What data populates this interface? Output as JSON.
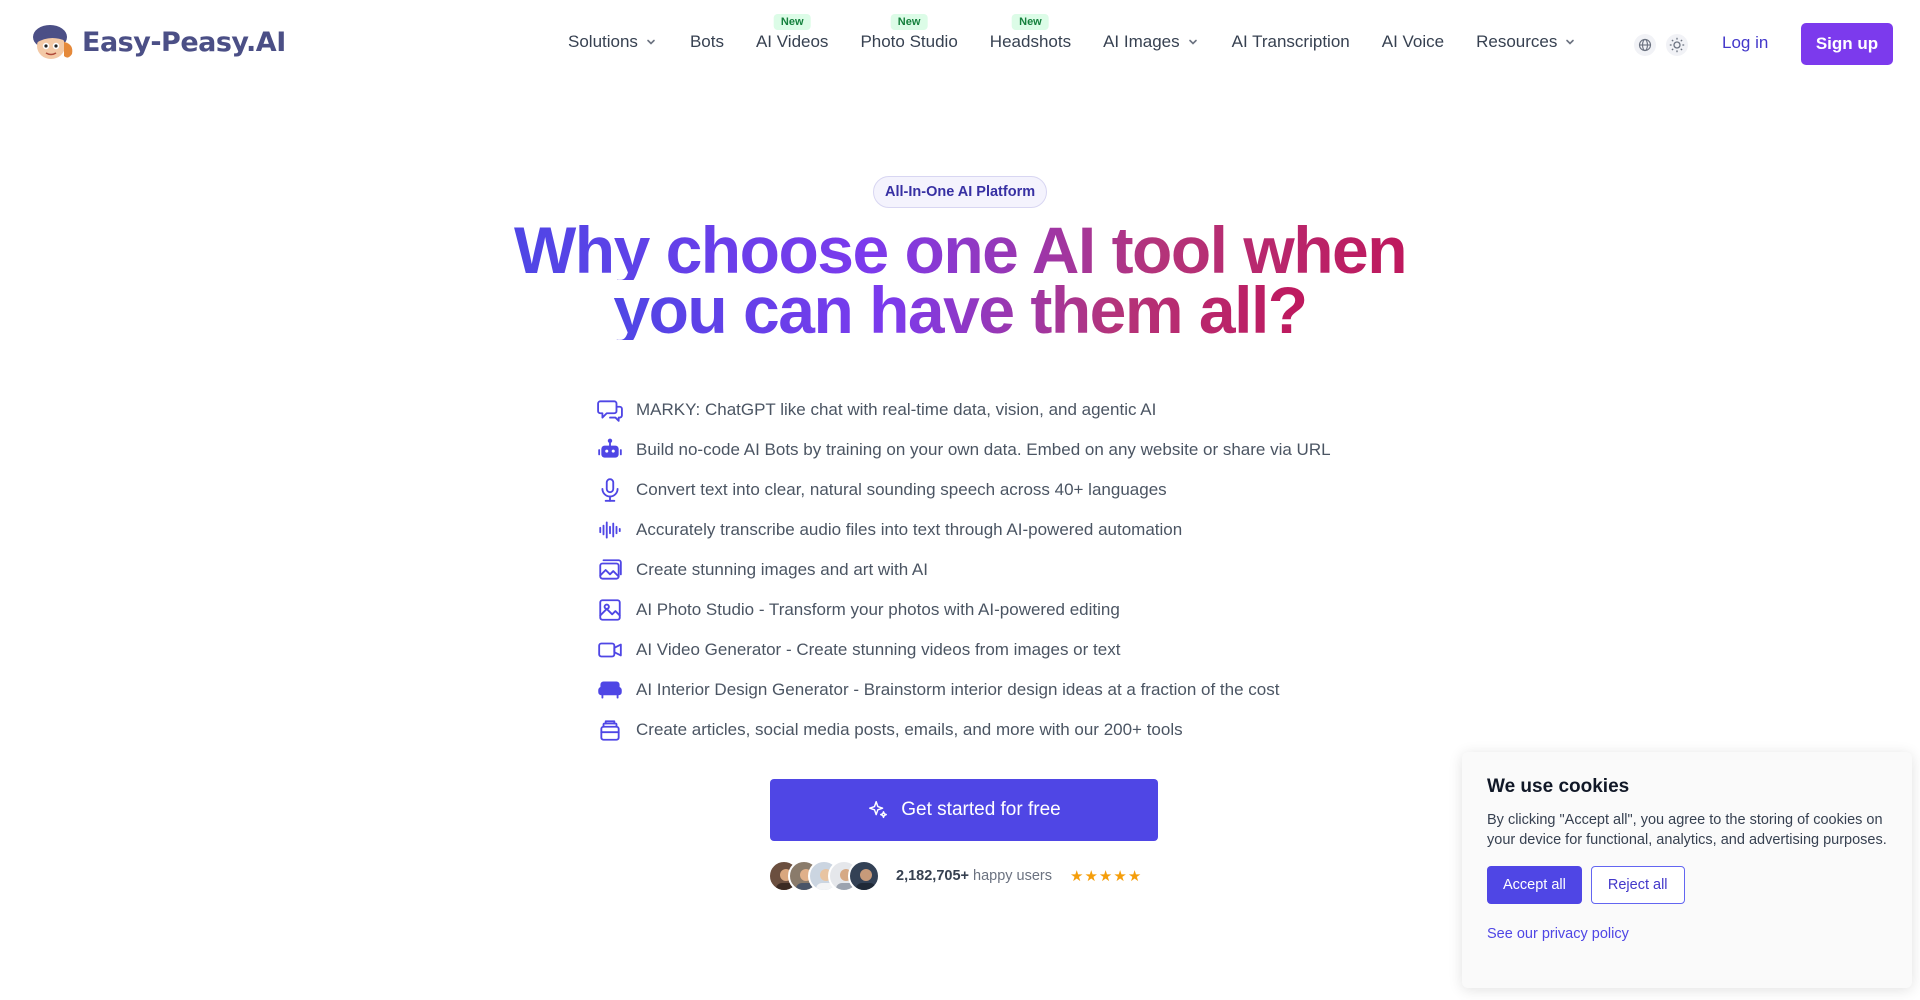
{
  "brand": {
    "name": "Easy-Peasy.AI",
    "accent": "#4f46e5",
    "cta_purple": "#7c3aed"
  },
  "nav": {
    "items": [
      {
        "label": "Solutions",
        "dropdown": true,
        "badge": ""
      },
      {
        "label": "Bots",
        "dropdown": false,
        "badge": ""
      },
      {
        "label": "AI Videos",
        "dropdown": false,
        "badge": "New"
      },
      {
        "label": "Photo Studio",
        "dropdown": false,
        "badge": "New"
      },
      {
        "label": "Headshots",
        "dropdown": false,
        "badge": "New"
      },
      {
        "label": "AI Images",
        "dropdown": true,
        "badge": ""
      },
      {
        "label": "AI Transcription",
        "dropdown": false,
        "badge": ""
      },
      {
        "label": "AI Voice",
        "dropdown": false,
        "badge": ""
      },
      {
        "label": "Resources",
        "dropdown": true,
        "badge": ""
      }
    ],
    "language_icon": "globe-icon",
    "theme_icon": "sun-icon",
    "login": "Log in",
    "signup": "Sign up"
  },
  "hero": {
    "pill": "All-In-One AI Platform",
    "headline_line1": "Why choose one AI tool when",
    "headline_line2": "you can have them all?",
    "features": [
      {
        "icon": "chat-icon",
        "text": "MARKY: ChatGPT like chat with real-time data, vision, and agentic AI"
      },
      {
        "icon": "robot-icon",
        "text": "Build no-code AI Bots by training on your own data. Embed on any website or share via URL"
      },
      {
        "icon": "microphone-icon",
        "text": "Convert text into clear, natural sounding speech across 40+ languages"
      },
      {
        "icon": "waveform-icon",
        "text": "Accurately transcribe audio files into text through AI-powered automation"
      },
      {
        "icon": "images-icon",
        "text": "Create stunning images and art with AI"
      },
      {
        "icon": "photo-icon",
        "text": "AI Photo Studio - Transform your photos with AI-powered editing"
      },
      {
        "icon": "video-icon",
        "text": "AI Video Generator - Create stunning videos from images or text"
      },
      {
        "icon": "sofa-icon",
        "text": "AI Interior Design Generator - Brainstorm interior design ideas at a fraction of the cost"
      },
      {
        "icon": "stack-icon",
        "text": "Create articles, social media posts, emails, and more with our 200+ tools"
      }
    ],
    "cta_label": "Get started for free",
    "user_count": "2,182,705+",
    "user_suffix": "happy users",
    "rating_stars": 5
  },
  "cookie": {
    "title": "We use cookies",
    "body": "By clicking \"Accept all\", you agree to the storing of cookies on your device for functional, analytics, and advertising purposes.",
    "accept": "Accept all",
    "reject": "Reject all",
    "privacy_link": "See our privacy policy"
  }
}
